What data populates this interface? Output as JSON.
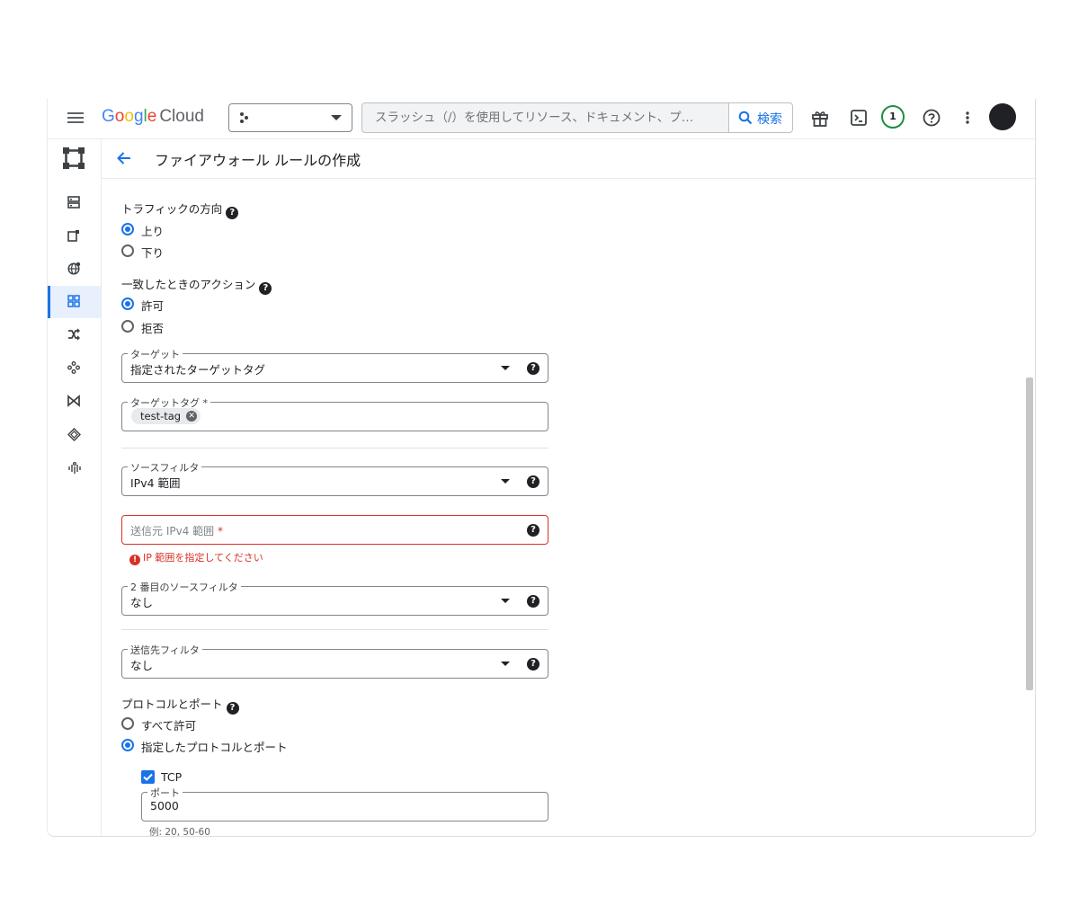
{
  "topbar": {
    "logo_google": "Google",
    "logo_cloud": "Cloud",
    "search_placeholder": "スラッシュ（/）を使用してリソース、ドキュメント、プ…",
    "search_button": "検索",
    "notification_count": "1"
  },
  "header": {
    "title": "ファイアウォール ルールの作成"
  },
  "form": {
    "direction": {
      "label": "トラフィックの方向",
      "options": [
        "上り",
        "下り"
      ],
      "selected": "上り"
    },
    "action": {
      "label": "一致したときのアクション",
      "options": [
        "許可",
        "拒否"
      ],
      "selected": "許可"
    },
    "target": {
      "label": "ターゲット",
      "value": "指定されたターゲットタグ"
    },
    "target_tags": {
      "label": "ターゲットタグ *",
      "chips": [
        "test-tag"
      ]
    },
    "source_filter": {
      "label": "ソースフィルタ",
      "value": "IPv4 範囲"
    },
    "source_ipv4": {
      "placeholder": "送信元 IPv4 範囲",
      "required_mark": "*",
      "error": "IP 範囲を指定してください"
    },
    "second_source_filter": {
      "label": "2 番目のソースフィルタ",
      "value": "なし"
    },
    "destination_filter": {
      "label": "送信先フィルタ",
      "value": "なし"
    },
    "protocols": {
      "label": "プロトコルとポート",
      "options": [
        "すべて許可",
        "指定したプロトコルとポート"
      ],
      "selected": "指定したプロトコルとポート"
    },
    "tcp": {
      "label": "TCP",
      "checked": true,
      "ports_label": "ポート",
      "ports_value": "5000",
      "ports_hint": "例: 20, 50-60"
    }
  },
  "colors": {
    "accent": "#1a73e8",
    "error": "#d93025",
    "badge_ring": "#1e8e3e"
  }
}
